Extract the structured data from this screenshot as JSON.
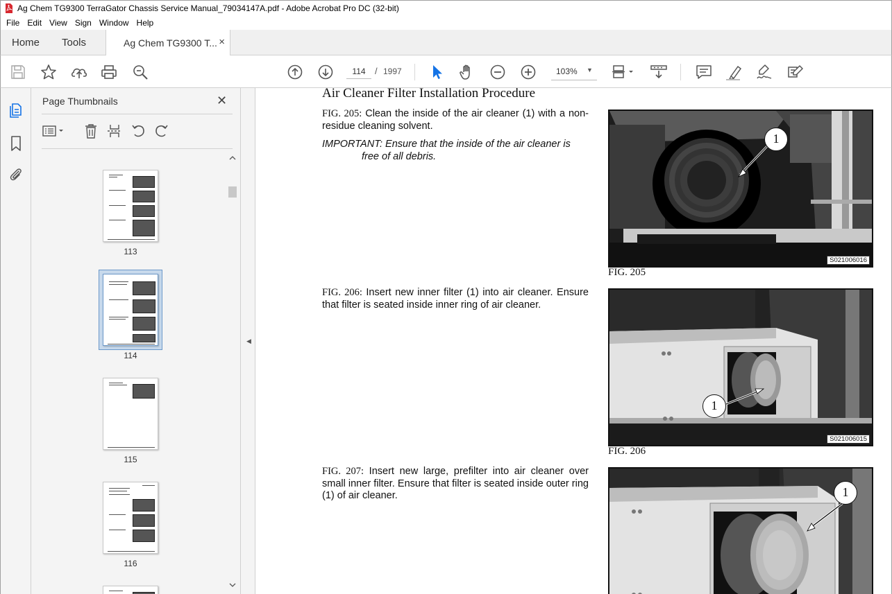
{
  "window": {
    "title": "Ag Chem TG9300 TerraGator Chassis Service Manual_79034147A.pdf - Adobe Acrobat Pro DC (32-bit)"
  },
  "menu": [
    "File",
    "Edit",
    "View",
    "Sign",
    "Window",
    "Help"
  ],
  "tabs": {
    "home": "Home",
    "tools": "Tools",
    "document": "Ag Chem TG9300 T...",
    "close": "×"
  },
  "toolbar": {
    "icons": [
      "save-icon",
      "bookmark-star-icon",
      "upload-icon",
      "print-icon",
      "zoom-search-icon",
      "previous-page-icon",
      "next-page-icon",
      "select-tool-icon",
      "hand-tool-icon",
      "zoom-out-icon",
      "zoom-in-icon",
      "page-fit-icon",
      "scroll-mode-icon",
      "comment-icon",
      "highlight-icon",
      "sign-icon",
      "fill-sign-icon"
    ],
    "current_page": "114",
    "page_separator": "/",
    "total_pages": "1997",
    "zoom": "103%"
  },
  "panel": {
    "title": "Page Thumbnails",
    "close": "✕",
    "thumbnails": [
      {
        "label": "113",
        "selected": false
      },
      {
        "label": "114",
        "selected": true
      },
      {
        "label": "115",
        "selected": false
      },
      {
        "label": "116",
        "selected": false
      }
    ]
  },
  "document": {
    "heading": "Air Cleaner Filter Installation Procedure",
    "sections": [
      {
        "fig_ref": "FIG. 205:",
        "text": " Clean the inside of the air cleaner (1) with a non-residue cleaning solvent.",
        "important": "IMPORTANT:  Ensure that the inside of the air cleaner is free of all debris.",
        "caption": "FIG. 205",
        "code": "S021006016",
        "callout": "1"
      },
      {
        "fig_ref": "FIG. 206:",
        "text": " Insert new inner filter (1) into air cleaner. Ensure that filter is seated inside inner ring of air cleaner.",
        "caption": "FIG. 206",
        "code": "S021006015",
        "callout": "1"
      },
      {
        "fig_ref": "FIG. 207:",
        "text": " Insert new large, prefilter into air cleaner over small inner filter. Ensure that filter is seated inside outer ring (1) of air cleaner.",
        "callout": "1"
      }
    ]
  },
  "colors": {
    "accent": "#1473e6",
    "selection": "#c7d9ec",
    "pdf_red": "#d7282f"
  }
}
